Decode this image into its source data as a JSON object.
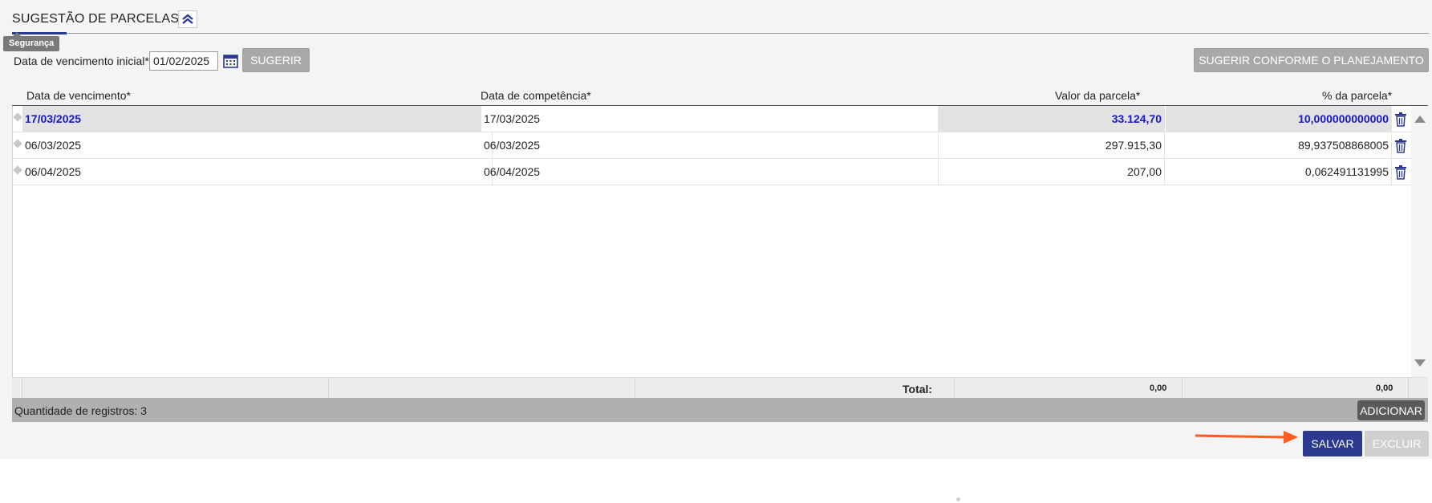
{
  "section": {
    "title": "SUGESTÃO DE PARCELAS",
    "tooltip": "Segurança"
  },
  "form": {
    "date_label": "Data de vencimento inicial*:",
    "date_value": "01/02/2025",
    "suggest_label": "SUGERIR",
    "suggest_planning_label": "SUGERIR CONFORME O PLANEJAMENTO"
  },
  "grid": {
    "columns": [
      "Data de vencimento*",
      "Data de competência*",
      "Valor da parcela*",
      "% da parcela*"
    ],
    "rows": [
      {
        "vencimento": "17/03/2025",
        "competencia": "17/03/2025",
        "valor": "33.124,70",
        "percentual": "10,000000000000",
        "selected": true
      },
      {
        "vencimento": "06/03/2025",
        "competencia": "06/03/2025",
        "valor": "297.915,30",
        "percentual": "89,937508868005",
        "selected": false
      },
      {
        "vencimento": "06/04/2025",
        "competencia": "06/04/2025",
        "valor": "207,00",
        "percentual": "0,062491131995",
        "selected": false
      }
    ],
    "total_label": "Total:",
    "total_valor": "0,00",
    "total_percentual": "0,00",
    "records_label": "Quantidade de registros: 3",
    "add_label": "ADICIONAR"
  },
  "actions": {
    "save_label": "SALVAR",
    "delete_label": "EXCLUIR"
  },
  "colors": {
    "primary": "#2b3a8f",
    "selected_text": "#1818c8",
    "annotation_arrow": "#ff5a1f",
    "disabled": "#cfcfcf"
  },
  "icons": [
    "chevron-double-up-icon",
    "calendar-icon",
    "trash-icon",
    "scroll-up-icon",
    "scroll-down-icon",
    "drag-handle-icon"
  ]
}
